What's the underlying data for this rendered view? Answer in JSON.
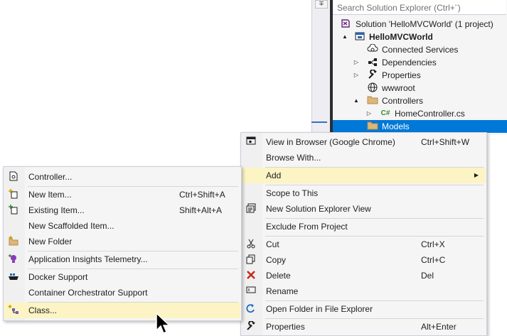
{
  "solution_explorer": {
    "search_placeholder": "Search Solution Explorer (Ctrl+¨)",
    "collapse_glyph": "∓",
    "items": [
      {
        "label": "Solution 'HelloMVCWorld' (1 project)",
        "icon": "solution-icon",
        "arrow": ""
      },
      {
        "label": "HelloMVCWorld",
        "icon": "project-icon",
        "arrow": "▲",
        "bold": true
      },
      {
        "label": "Connected Services",
        "icon": "connected-services-icon",
        "arrow": ""
      },
      {
        "label": "Dependencies",
        "icon": "dependencies-icon",
        "arrow": "▷"
      },
      {
        "label": "Properties",
        "icon": "wrench-icon",
        "arrow": "▷"
      },
      {
        "label": "wwwroot",
        "icon": "globe-icon",
        "arrow": ""
      },
      {
        "label": "Controllers",
        "icon": "folder-icon",
        "arrow": "▲"
      },
      {
        "label": "HomeController.cs",
        "icon": "csharp-file-icon",
        "icon_text": "C#",
        "arrow": "▷"
      },
      {
        "label": "Models",
        "icon": "folder-icon",
        "arrow": "",
        "selected": true
      }
    ]
  },
  "context_menu": {
    "items": [
      {
        "label": "View in Browser (Google Chrome)",
        "shortcut": "Ctrl+Shift+W",
        "icon": "view-in-browser-icon"
      },
      {
        "label": "Browse With...",
        "shortcut": "",
        "icon": ""
      },
      {
        "label": "Add",
        "shortcut": "",
        "icon": "",
        "submenu_arrow": "▶"
      },
      {
        "label": "Scope to This",
        "shortcut": "",
        "icon": ""
      },
      {
        "label": "New Solution Explorer View",
        "shortcut": "",
        "icon": "new-view-icon"
      },
      {
        "label": "Exclude From Project",
        "shortcut": "",
        "icon": ""
      },
      {
        "label": "Cut",
        "shortcut": "Ctrl+X",
        "icon": "scissors-icon"
      },
      {
        "label": "Copy",
        "shortcut": "Ctrl+C",
        "icon": "copy-icon"
      },
      {
        "label": "Delete",
        "shortcut": "Del",
        "icon": "delete-icon"
      },
      {
        "label": "Rename",
        "shortcut": "",
        "icon": "rename-icon"
      },
      {
        "label": "Open Folder in File Explorer",
        "shortcut": "",
        "icon": "refresh-arrow-icon"
      },
      {
        "label": "Properties",
        "shortcut": "Alt+Enter",
        "icon": "wrench-icon"
      }
    ]
  },
  "add_submenu": {
    "items": [
      {
        "label": "Controller...",
        "shortcut": "",
        "icon": "controller-icon"
      },
      {
        "label": "New Item...",
        "shortcut": "Ctrl+Shift+A",
        "icon": "new-item-icon"
      },
      {
        "label": "Existing Item...",
        "shortcut": "Shift+Alt+A",
        "icon": "existing-item-icon"
      },
      {
        "label": "New Scaffolded Item...",
        "shortcut": "",
        "icon": ""
      },
      {
        "label": "New Folder",
        "shortcut": "",
        "icon": "new-folder-icon"
      },
      {
        "label": "Application Insights Telemetry...",
        "shortcut": "",
        "icon": "app-insights-icon"
      },
      {
        "label": "Docker Support",
        "shortcut": "",
        "icon": "docker-icon"
      },
      {
        "label": "Container Orchestrator Support",
        "shortcut": "",
        "icon": ""
      },
      {
        "label": "Class...",
        "shortcut": "",
        "icon": "add-class-icon"
      }
    ]
  },
  "colors": {
    "selection_blue": "#0078d7",
    "menu_highlight": "#fcf4c4",
    "menu_background": "#f5f5f5"
  }
}
